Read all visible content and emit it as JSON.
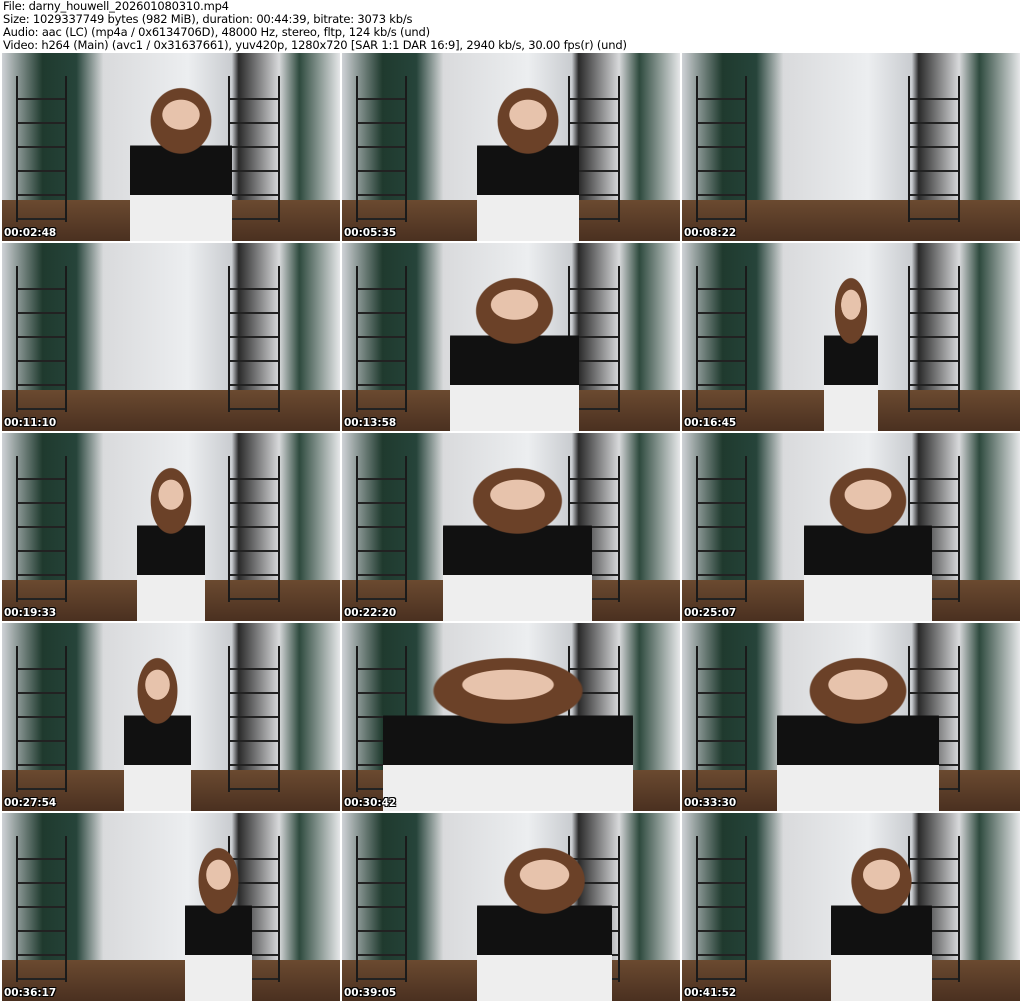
{
  "header": {
    "file": "File: darny_houwell_202601080310.mp4",
    "size": "Size: 1029337749 bytes (982 MiB), duration: 00:44:39, bitrate: 3073 kb/s",
    "audio": "Audio: aac (LC) (mp4a / 0x6134706D), 48000 Hz, stereo, fltp, 124 kb/s (und)",
    "video": "Video: h264 (Main) (avc1 / 0x31637661), yuv420p, 1280x720 [SAR 1:1 DAR 16:9], 2940 kb/s, 30.00 fps(r) (und)"
  },
  "thumbnails": [
    "00:02:48",
    "00:05:35",
    "00:08:22",
    "00:11:10",
    "00:13:58",
    "00:16:45",
    "00:19:33",
    "00:22:20",
    "00:25:07",
    "00:27:54",
    "00:30:42",
    "00:33:30",
    "00:36:17",
    "00:39:05",
    "00:41:52"
  ]
}
